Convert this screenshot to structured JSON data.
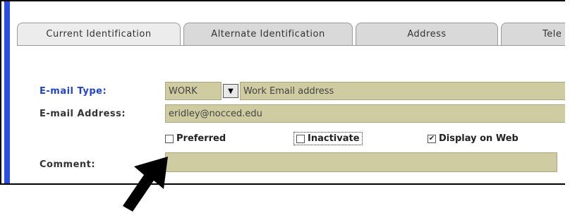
{
  "tabs": [
    {
      "label": "Current Identification"
    },
    {
      "label": "Alternate Identification"
    },
    {
      "label": "Address"
    },
    {
      "label": "Tele"
    }
  ],
  "form": {
    "email_type_label": "E-mail Type:",
    "email_type_value": "WORK",
    "email_type_desc": "Work Email address",
    "email_address_label": "E-mail Address:",
    "email_address_value": "eridley@nocced.edu",
    "preferred_label": "Preferred",
    "inactivate_label": "Inactivate",
    "display_web_label": "Display on Web",
    "display_web_check": "✔",
    "comment_label": "Comment:",
    "comment_value": ""
  },
  "icons": {
    "dropdown": "chevron-down-icon",
    "pointer": "arrow-pointer-icon"
  },
  "colors": {
    "accent_bar": "#2b50e0",
    "field_bg": "#cfcca1",
    "label_blue": "#2244cc"
  },
  "checkboxes": {
    "preferred": false,
    "inactivate": false,
    "display_on_web": true
  }
}
